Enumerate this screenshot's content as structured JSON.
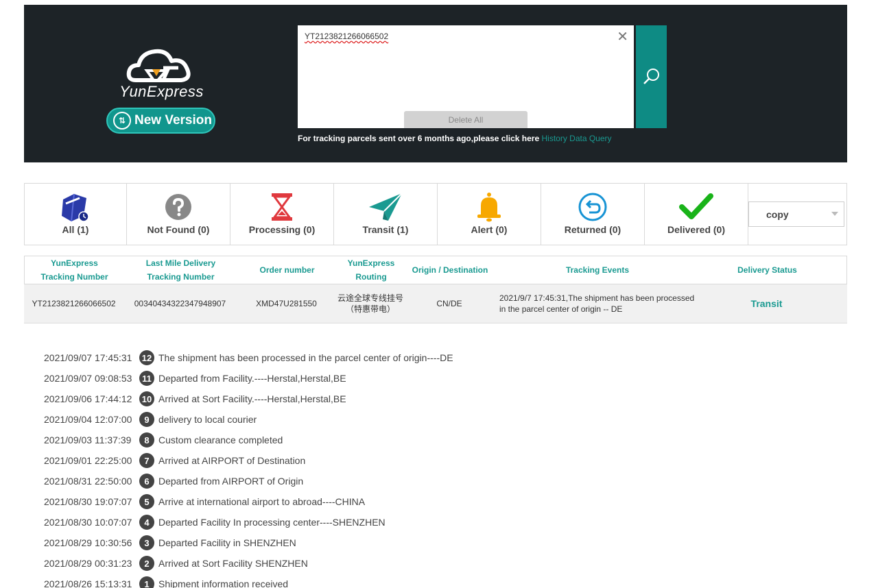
{
  "header": {
    "brand": "YunExpress",
    "new_version_label": "New Version",
    "search_value": "YT2123821266066502",
    "delete_all_label": "Delete All",
    "history_text": "For tracking parcels sent over 6 months ago,please click here ",
    "history_link": "History Data Query"
  },
  "tabs": [
    {
      "label": "All (1)",
      "icon": "package-icon"
    },
    {
      "label": "Not Found (0)",
      "icon": "question-icon"
    },
    {
      "label": "Processing (0)",
      "icon": "hourglass-icon"
    },
    {
      "label": "Transit (1)",
      "icon": "paper-plane-icon"
    },
    {
      "label": "Alert (0)",
      "icon": "bell-icon"
    },
    {
      "label": "Returned (0)",
      "icon": "return-icon"
    },
    {
      "label": "Delivered (0)",
      "icon": "checkmark-icon"
    }
  ],
  "copy_select": {
    "value": "copy"
  },
  "table": {
    "headers": {
      "tracking_l1": "YunExpress",
      "tracking_l2": "Tracking Number",
      "lastmile_l1": "Last Mile Delivery",
      "lastmile_l2": "Tracking Number",
      "order": "Order number",
      "routing_l1": "YunExpress",
      "routing_l2": "Routing",
      "origin": "Origin / Destination",
      "events": "Tracking Events",
      "status": "Delivery Status"
    },
    "rows": [
      {
        "tracking": "YT2123821266066502",
        "lastmile": "00340434322347948907",
        "order": "XMD47U281550",
        "routing": "云途全球专线挂号（特惠带电）",
        "origin": "CN/DE",
        "event": "2021/9/7 17:45:31,The shipment has been processed in the parcel center of origin -- DE",
        "status": "Transit"
      }
    ]
  },
  "events": [
    {
      "time": "2021/09/07 17:45:31",
      "num": "12",
      "desc": "The shipment has been processed in the parcel center of origin----DE"
    },
    {
      "time": "2021/09/07 09:08:53",
      "num": "11",
      "desc": "Departed from Facility.----Herstal,Herstal,BE"
    },
    {
      "time": "2021/09/06 17:44:12",
      "num": "10",
      "desc": "Arrived at Sort Facility.----Herstal,Herstal,BE"
    },
    {
      "time": "2021/09/04 12:07:00",
      "num": "9",
      "desc": "delivery to local courier"
    },
    {
      "time": "2021/09/03 11:37:39",
      "num": "8",
      "desc": "Custom clearance completed"
    },
    {
      "time": "2021/09/01 22:25:00",
      "num": "7",
      "desc": "Arrived at AIRPORT of Destination"
    },
    {
      "time": "2021/08/31 22:50:00",
      "num": "6",
      "desc": "Departed from AIRPORT of Origin"
    },
    {
      "time": "2021/08/30 19:07:07",
      "num": "5",
      "desc": "Arrive at international airport to abroad----CHINA"
    },
    {
      "time": "2021/08/30 10:07:07",
      "num": "4",
      "desc": "Departed Facility In processing center----SHENZHEN"
    },
    {
      "time": "2021/08/29 10:30:56",
      "num": "3",
      "desc": "Departed Facility in SHENZHEN"
    },
    {
      "time": "2021/08/29 00:31:23",
      "num": "2",
      "desc": "Arrived at Sort Facility SHENZHEN"
    },
    {
      "time": "2021/08/26 15:13:31",
      "num": "1",
      "desc": "Shipment information received"
    }
  ],
  "colors": {
    "accent": "#1a9a91",
    "header_bg": "#1d2327"
  }
}
